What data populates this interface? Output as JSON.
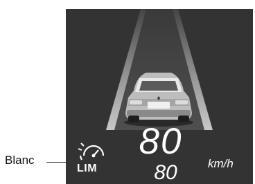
{
  "callout": {
    "label": "Blanc"
  },
  "hud": {
    "current_speed": "80",
    "set_speed": "80",
    "unit": "km/h",
    "limiter_icon": "speed-limiter-icon",
    "limiter_text": "LIM",
    "icon_color": "#ffffff",
    "background_color": "#333333"
  }
}
